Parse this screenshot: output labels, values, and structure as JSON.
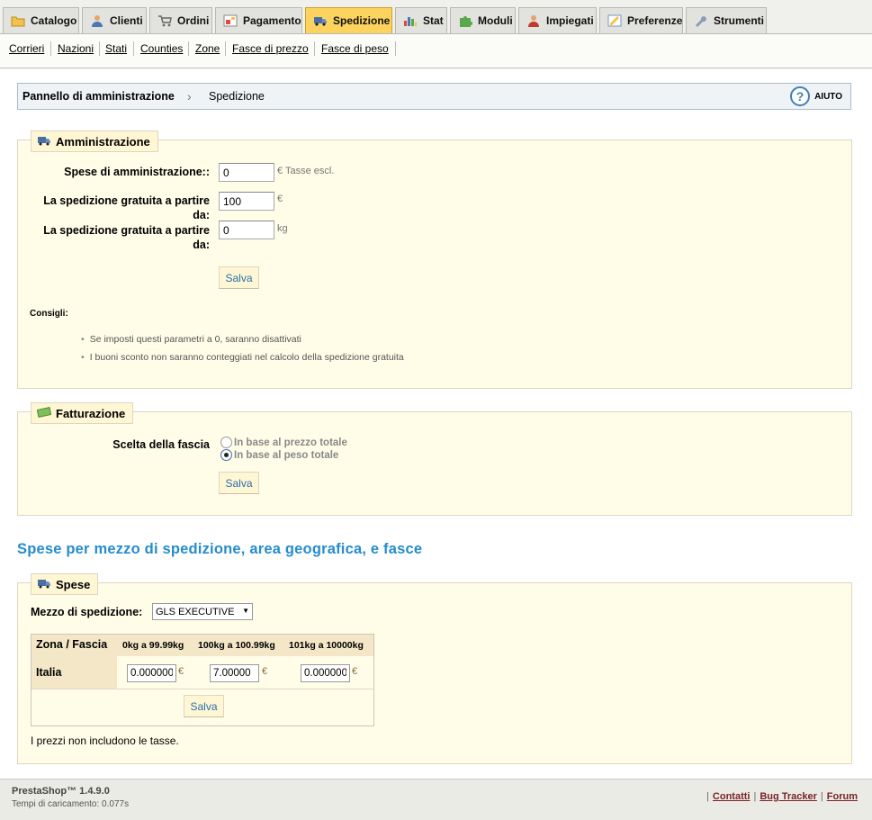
{
  "tabs": [
    {
      "label": "Catalogo",
      "icon": "folder-icon"
    },
    {
      "label": "Clienti",
      "icon": "user-icon"
    },
    {
      "label": "Ordini",
      "icon": "cart-icon"
    },
    {
      "label": "Pagamento",
      "icon": "payment-icon"
    },
    {
      "label": "Spedizione",
      "icon": "truck-icon",
      "active": true
    },
    {
      "label": "Stat",
      "icon": "chart-icon"
    },
    {
      "label": "Moduli",
      "icon": "puzzle-icon"
    },
    {
      "label": "Impiegati",
      "icon": "employee-icon"
    },
    {
      "label": "Preferenze",
      "icon": "preferences-icon"
    },
    {
      "label": "Strumenti",
      "icon": "wrench-icon"
    }
  ],
  "subtabs": [
    "Corrieri",
    "Nazioni",
    "Stati",
    "Counties",
    "Zone",
    "Fasce di prezzo",
    "Fasce di peso"
  ],
  "breadcrumb": {
    "home": "Pannello di amministrazione",
    "current": "Spedizione",
    "help": "AIUTO"
  },
  "admin": {
    "legend": "Amministrazione",
    "handling_label": "Spese di amministrazione::",
    "handling_value": "0",
    "handling_unit": "€ Tasse escl.",
    "free_price_label_1": "La spedizione gratuita a partire",
    "free_price_label_2": "da:",
    "free_price_value": "100",
    "free_price_unit": "€",
    "free_weight_label_1": "La spedizione gratuita a partire",
    "free_weight_label_2": "da:",
    "free_weight_value": "0",
    "free_weight_unit": "kg",
    "save": "Salva",
    "tips_title": "Consigli:",
    "tips": [
      "Se imposti questi parametri a 0, saranno disattivati",
      "I buoni sconto non saranno conteggiati nel calcolo della spedizione gratuita"
    ]
  },
  "billing": {
    "legend": "Fatturazione",
    "label": "Scelta della fascia",
    "option_price": "In base al prezzo totale",
    "option_weight": "In base al peso totale",
    "selected": "weight",
    "save": "Salva"
  },
  "fees_title": "Spese per mezzo di spedizione, area geografica, e fasce",
  "fees": {
    "legend": "Spese",
    "carrier_label": "Mezzo di spedizione:",
    "carrier_value": "GLS EXECUTIVE",
    "header_main": "Zona / Fascia",
    "ranges": [
      "0kg a 99.99kg",
      "100kg a 100.99kg",
      "101kg a 10000kg"
    ],
    "zone": "Italia",
    "values": [
      "0.000000",
      "7.00000",
      "0.000000"
    ],
    "currency": "€",
    "save": "Salva",
    "note": "I prezzi non includono le tasse."
  },
  "footer": {
    "title": "PrestaShop™ 1.4.9.0",
    "time": "Tempi di caricamento: 0.077s",
    "links": [
      "Contatti",
      "Bug Tracker",
      "Forum"
    ]
  },
  "colors": {
    "accent_tab": "#fcd35e",
    "heading_blue": "#268ccd",
    "fieldset_bg": "#fffde8"
  }
}
